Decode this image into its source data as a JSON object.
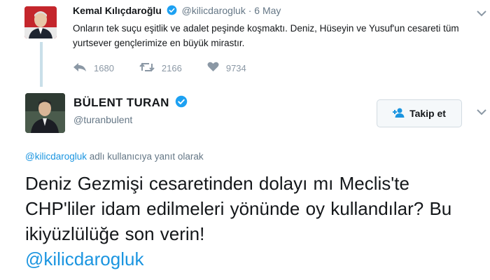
{
  "parent_tweet": {
    "author_name": "Kemal Kılıçdaroğlu",
    "author_handle": "@kilicdarogluk",
    "separator": "·",
    "date": "6 May",
    "body": "Onların tek suçu eşitlik ve adalet peşinde koşmaktı. Deniz, Hüseyin ve Yusuf'un cesareti tüm yurtsever gençlerimize en büyük mirastır.",
    "replies": "1680",
    "retweets": "2166",
    "likes": "9734"
  },
  "main_tweet": {
    "author_name": "BÜLENT TURAN",
    "author_handle": "@turanbulent",
    "follow_label": "Takip et",
    "reply_mention": "@kilicdarogluk",
    "reply_suffix": " adlı kullanıcıya yanıt olarak",
    "text": "Deniz Gezmişi cesaretinden dolayı mı Meclis'te CHP'liler idam edilmeleri yönünde oy kullandılar? Bu ikiyüzlülüğe son verin!",
    "mention": "@kilicdarogluk"
  },
  "colors": {
    "accent": "#1b95e0",
    "verified": "#1da1f2",
    "muted": "#657786",
    "thread_line": "#c9dfe9"
  },
  "icons": [
    "verified-badge-icon",
    "reply-icon",
    "retweet-icon",
    "like-icon",
    "chevron-down-icon",
    "add-user-icon"
  ]
}
